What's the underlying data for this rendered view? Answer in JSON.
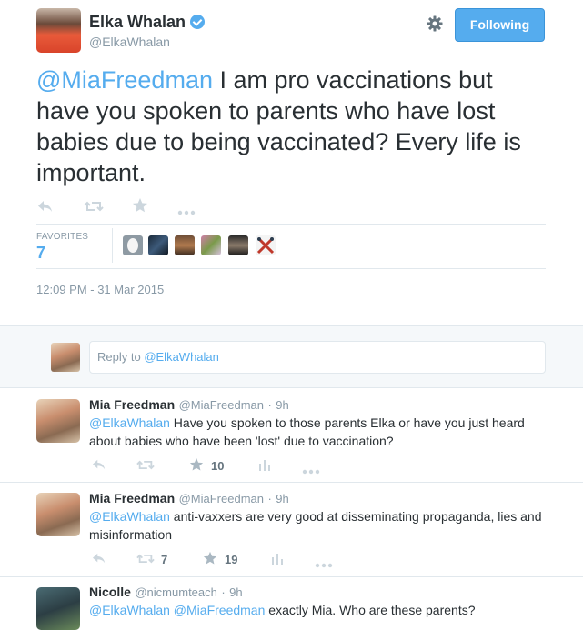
{
  "author": {
    "name": "Elka Whalan",
    "handle": "@ElkaWhalan",
    "follow_label": "Following"
  },
  "tweet": {
    "mention": "@MiaFreedman",
    "text_rest": " I am pro vaccinations but have you spoken to parents who have lost babies due to being vaccinated? Every life is important.",
    "favorites_label": "FAVORITES",
    "favorites_count": "7",
    "timestamp": "12:09 PM - 31 Mar 2015"
  },
  "reply_box": {
    "prefix": "Reply to ",
    "target": "@ElkaWhalan"
  },
  "replies": [
    {
      "name": "Mia Freedman",
      "handle": "@MiaFreedman",
      "time": "9h",
      "mention": "@ElkaWhalan",
      "text": " Have you spoken to those parents Elka or have you just heard about babies who have been 'lost' due to vaccination?",
      "retweets": "",
      "favorites": "10"
    },
    {
      "name": "Mia Freedman",
      "handle": "@MiaFreedman",
      "time": "9h",
      "mention": "@ElkaWhalan",
      "text": " anti-vaxxers are very good at disseminating propaganda, lies and misinformation",
      "retweets": "7",
      "favorites": "19"
    },
    {
      "name": "Nicolle",
      "handle": "@nicmumteach",
      "time": "9h",
      "mention": "@ElkaWhalan @MiaFreedman",
      "text": " exactly Mia. Who are these parents?"
    }
  ],
  "colors": {
    "accent": "#55acee",
    "text": "#292f33",
    "muted": "#8899a6",
    "reply_area_bg": "#f5f8fa"
  }
}
